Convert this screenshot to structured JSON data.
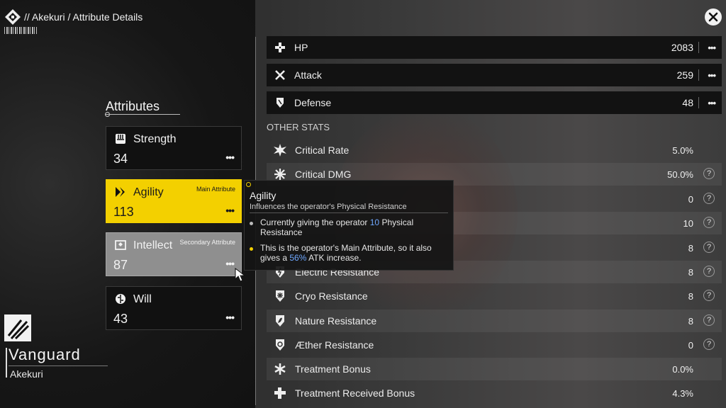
{
  "header": {
    "breadcrumb": "// Akekuri / Attribute Details"
  },
  "attributes": {
    "title": "Attributes",
    "items": [
      {
        "name": "Strength",
        "value": "34",
        "tag": "",
        "icon": "fist-icon"
      },
      {
        "name": "Agility",
        "value": "113",
        "tag": "Main Attribute",
        "icon": "agility-icon"
      },
      {
        "name": "Intellect",
        "value": "87",
        "tag": "Secondary Attribute",
        "icon": "book-icon"
      },
      {
        "name": "Will",
        "value": "43",
        "tag": "",
        "icon": "brain-icon"
      }
    ],
    "more_label": "•••"
  },
  "character": {
    "class_name": "Vanguard",
    "name": "Akekuri"
  },
  "main_stats": [
    {
      "label": "HP",
      "value": "2083",
      "icon": "hp-cross-icon"
    },
    {
      "label": "Attack",
      "value": "259",
      "icon": "crossed-swords-icon"
    },
    {
      "label": "Defense",
      "value": "48",
      "icon": "shield-icon"
    }
  ],
  "other_stats": {
    "title": "OTHER STATS",
    "rows": [
      {
        "label": "Critical Rate",
        "value": "5.0%",
        "help": false
      },
      {
        "label": "Critical DMG",
        "value": "50.0%",
        "help": true
      },
      {
        "label": "",
        "value": "0",
        "help": true
      },
      {
        "label": "",
        "value": "10",
        "help": true
      },
      {
        "label": "",
        "value": "8",
        "help": true
      },
      {
        "label": "Electric Resistance",
        "value": "8",
        "help": true
      },
      {
        "label": "Cryo Resistance",
        "value": "8",
        "help": true
      },
      {
        "label": "Nature Resistance",
        "value": "8",
        "help": true
      },
      {
        "label": "Æther Resistance",
        "value": "0",
        "help": true
      },
      {
        "label": "Treatment Bonus",
        "value": "0.0%",
        "help": false
      },
      {
        "label": "Treatment Received Bonus",
        "value": "4.3%",
        "help": false
      }
    ],
    "help_glyph": "?"
  },
  "tooltip": {
    "title": "Agility",
    "subtitle": "Influences the operator's Physical Resistance",
    "b1_pre": "Currently giving the operator ",
    "b1_hl": "10",
    "b1_post": " Physical Resistance",
    "b2_pre": "This is the operator's Main Attribute, so it also gives a ",
    "b2_hl": "56%",
    "b2_post": " ATK increase."
  },
  "colors": {
    "main_attribute": "#f3d000",
    "secondary_attribute": "#8f8f8f",
    "highlight": "#6fa8ff"
  }
}
